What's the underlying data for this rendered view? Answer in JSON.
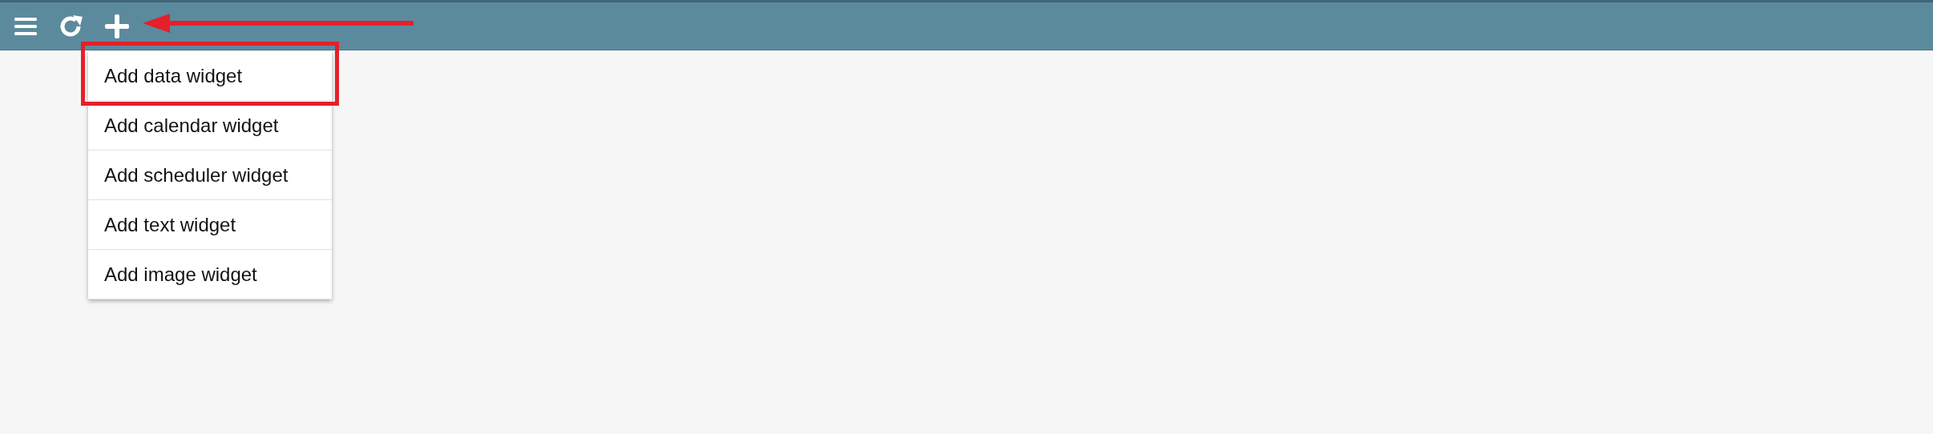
{
  "add_menu": {
    "items": [
      {
        "label": "Add data widget",
        "highlighted": true
      },
      {
        "label": "Add calendar widget",
        "highlighted": false
      },
      {
        "label": "Add scheduler widget",
        "highlighted": false
      },
      {
        "label": "Add text widget",
        "highlighted": false
      },
      {
        "label": "Add image widget",
        "highlighted": false
      }
    ]
  }
}
